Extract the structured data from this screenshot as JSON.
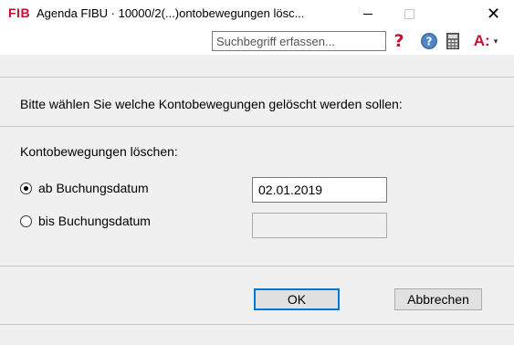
{
  "window": {
    "logo": "FIB",
    "title": "Agenda FIBU · 10000/2(...)ontobewegungen lösc...",
    "minimize_icon": "minimize-icon",
    "maximize_icon": "maximize-icon",
    "close_label": "✕"
  },
  "toolbar": {
    "search_placeholder": "Suchbegriff erfassen...",
    "search_value": "",
    "qmark_label": "?",
    "help_icon": "help-circle-icon",
    "calculator_icon": "calculator-icon",
    "font_label": "A:",
    "font_dropdown": "▾",
    "colors": {
      "accent_red": "#c8102e",
      "help_blue": "#3a6ea5"
    }
  },
  "dialog": {
    "instruction": "Bitte wählen Sie welche Kontobewegungen gelöscht werden sollen:",
    "group_label": "Kontobewegungen löschen:",
    "options": [
      {
        "label": "ab Buchungsdatum",
        "checked": true,
        "date_value": "02.01.2019"
      },
      {
        "label": "bis Buchungsdatum",
        "checked": false,
        "date_value": ""
      }
    ],
    "ok_label": "OK",
    "cancel_label": "Abbrechen"
  }
}
